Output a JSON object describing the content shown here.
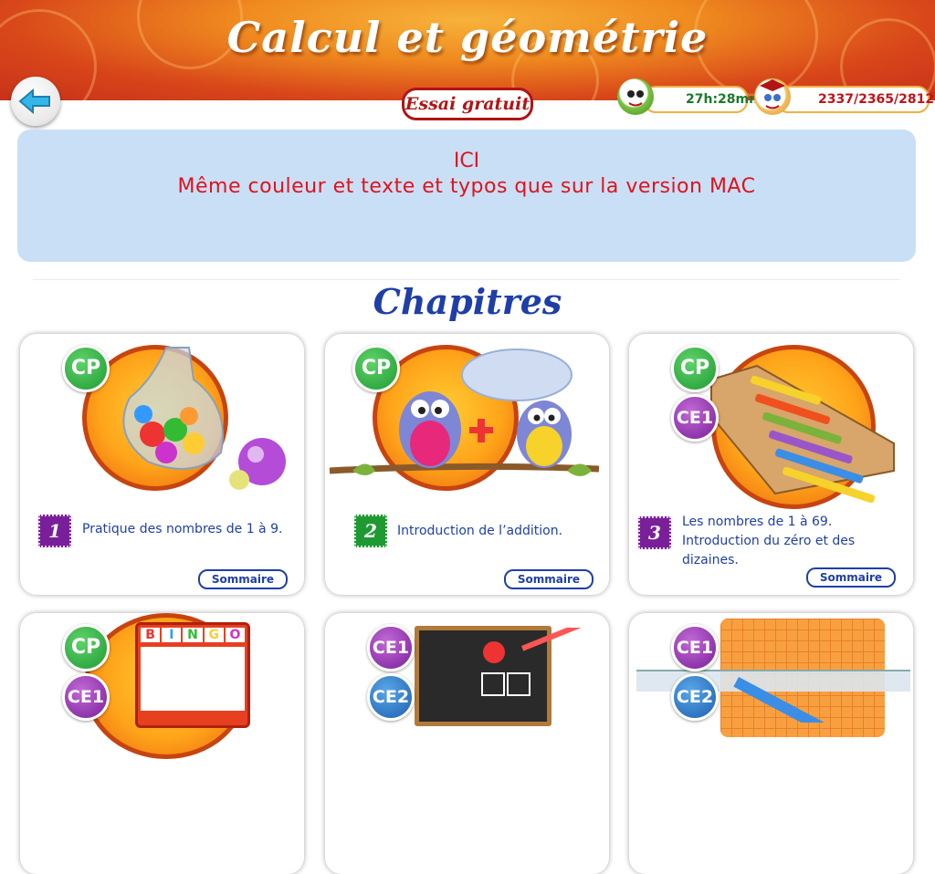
{
  "header": {
    "title": "Calcul et géométrie",
    "trial_label": "Essai gratuit",
    "time_counter": "27h:28mn",
    "score_counter": "2337/2365/2812"
  },
  "info_panel": {
    "line1": "ICI",
    "line2": "Même couleur et texte et typos que sur la version MAC"
  },
  "section_title": "Chapitres",
  "chapters": [
    {
      "number": "1",
      "levels": [
        "CP"
      ],
      "description": "Pratique des nombres de 1 à 9.",
      "button": "Sommaire",
      "color": "#7a1f9a"
    },
    {
      "number": "2",
      "levels": [
        "CP"
      ],
      "description": "Introduction de l’addition.",
      "button": "Sommaire",
      "color": "#1f9a32"
    },
    {
      "number": "3",
      "levels": [
        "CP",
        "CE1"
      ],
      "description": "Les nombres de 1 à 69. Introduction du zéro et des dizaines.",
      "button": "Sommaire",
      "color": "#7a1f9a"
    },
    {
      "levels": [
        "CP",
        "CE1"
      ],
      "bingo": [
        "B",
        "I",
        "N",
        "G",
        "O"
      ]
    },
    {
      "levels": [
        "CE1",
        "CE2"
      ]
    },
    {
      "levels": [
        "CE1",
        "CE2"
      ]
    }
  ],
  "colors": {
    "accent_red": "#c0131a",
    "title_blue": "#1f3fa7",
    "panel_bg": "#c9dff6"
  }
}
